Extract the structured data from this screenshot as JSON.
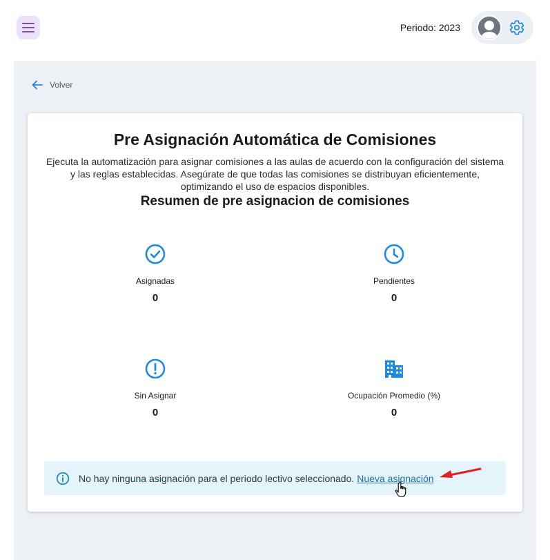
{
  "header": {
    "menu_icon": "hamburger-menu-icon",
    "period_text": "Periodo: 2023",
    "avatar_icon": "user-avatar",
    "settings_icon": "gear-icon"
  },
  "back": {
    "label": "Volver",
    "icon": "arrow-left-icon"
  },
  "card": {
    "title": "Pre Asignación Automática de Comisiones",
    "description": "Ejecuta la automatización para asignar comisiones a las aulas de acuerdo con la configuración del sistema y las reglas establecidas. Asegúrate de que todas las comisiones se distribuyan eficientemente, optimizando el uso de espacios disponibles.",
    "subtitle": "Resumen de pre asignacion de comisiones",
    "stats": [
      {
        "label": "Asignadas",
        "value": "0",
        "icon": "check-circle-icon"
      },
      {
        "label": "Pendientes",
        "value": "0",
        "icon": "clock-icon"
      },
      {
        "label": "Sin Asignar",
        "value": "0",
        "icon": "exclamation-circle-icon"
      },
      {
        "label": "Ocupación Promedio (%)",
        "value": "0",
        "icon": "building-icon"
      }
    ]
  },
  "alert": {
    "icon": "info-circle-icon",
    "text": "No hay ninguna asignación para el periodo lectivo seleccionado.",
    "link_label": "Nueva asignación"
  },
  "colors": {
    "accent_blue": "#1e88e5",
    "menu_purple": "#7b4fb0",
    "background": "#edf0f4",
    "alert_bg": "#e4f4fa",
    "annotation_red": "#e02020"
  }
}
